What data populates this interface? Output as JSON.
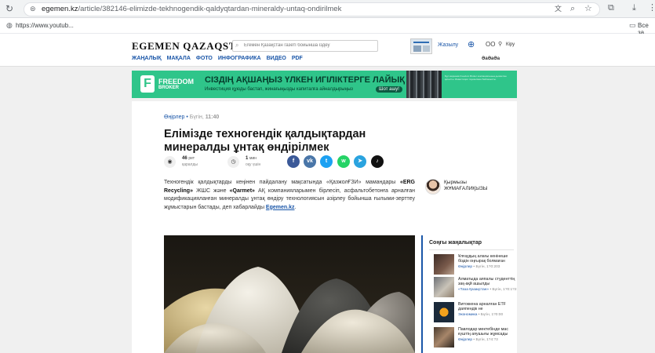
{
  "browser": {
    "url_domain": "egemen.kz",
    "url_path": "/article/382146-elimizde-tekhnogendik-qaldyqtardan-mineraldy-untaq-ondirilmek",
    "bookmark_left": "https://www.youtub...",
    "bookmark_right": "Все за"
  },
  "header": {
    "logo": "EGEMEN QAZAQSTAN",
    "search_placeholder": "Егемен Қазақстан газеті бойынша іздеу",
    "subscribe": "Жазылу",
    "login": "Кіру",
    "lang": "ӘаӘаӘа",
    "nav": [
      "ЖАҢАЛЫҚ",
      "МАҚАЛА",
      "ФОТО",
      "ИНФОГРАФИКА",
      "ВИДЕО",
      "PDF"
    ]
  },
  "banner": {
    "brand_line1": "FREEDOM",
    "brand_line2": "BROKER",
    "headline": "СІЗДІҢ АҚШАҢЫЗ ҮЛКЕН ИГІЛІКТЕРГЕ ЛАЙЫҚ",
    "subline": "Инвестиция құюды бастап, жинағыңызды капиталға айналдырыңыз",
    "cta": "Шот ашу!",
    "fineprint": "Бұл жарнама Freedom Broker компаниясының қызметіне қатысты. Инвестиция тәуекелмен байланысты."
  },
  "article": {
    "category": "Өңірлер",
    "date": "Бүгін,",
    "time": "11:40",
    "title": "Елімізде техногендік қалдықтардан минералды ұнтақ өндірілмек",
    "views_count": "46",
    "views_unit": "рет",
    "views_label": "қаралды",
    "read_count": "1",
    "read_unit": "мин",
    "read_label": "оқу үшін",
    "author": "Қырмызы ЖҰМАҒАЛИҚЫЗЫ",
    "lead_1": "Техногендік қалдықтарды кеңінен пайдалану мақсатында «ҚазжолҒЗИ» мамандары ",
    "lead_b1": "«ERG Recycling»",
    "lead_2": " ЖШС және ",
    "lead_b2": "«Qarmet»",
    "lead_3": " АҚ компанияларымен бірлесіп, асфальтобетонға арналған модификацияланған минералды ұнтақ өндіру технологиясын әзірлеу бойынша ғылыми-зерттеу жұмыстарын бастады, деп хабарлайды ",
    "lead_link": "Egemen.kz",
    "lead_end": "."
  },
  "share": [
    {
      "name": "facebook",
      "glyph": "f",
      "color": "#3b5998"
    },
    {
      "name": "vk",
      "glyph": "vk",
      "color": "#4a76a8"
    },
    {
      "name": "twitter",
      "glyph": "t",
      "color": "#1da1f2"
    },
    {
      "name": "whatsapp",
      "glyph": "w",
      "color": "#25d366"
    },
    {
      "name": "telegram",
      "glyph": "➤",
      "color": "#2aa3df"
    },
    {
      "name": "tiktok",
      "glyph": "♪",
      "color": "#111111"
    }
  ],
  "latest_news": {
    "title": "Соңғы жаңалықтар",
    "items": [
      {
        "title": "Ұлғаудың алағы кенінеше біздін оңғырақ болмаған",
        "category": "Өңірлер",
        "date": "Бүгін, 1?0:203"
      },
      {
        "title": "Алматыда аяпалы студенттің зақ-ақй ашылды",
        "category": "«Таза Қазақстан»",
        "date": "Бүгін, 1?0:1?2"
      },
      {
        "title": "Витоккена арналған ETF даяпендік не",
        "category": "Экономика",
        "date": "Бүгін, 1?0:00"
      },
      {
        "title": "Павлодар мектебінде мас күштің аяушығы жұмсады",
        "category": "Өңірлер",
        "date": "Бүгін, 1?4:?3"
      }
    ]
  }
}
